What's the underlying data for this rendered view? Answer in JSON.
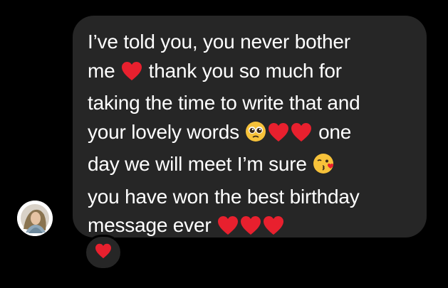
{
  "message": {
    "lines": [
      {
        "before": "I’ve told you, you never bother",
        "emojis": [],
        "after": ""
      },
      {
        "before": "me ",
        "emojis": [
          "heart"
        ],
        "after": " thank you so much for"
      },
      {
        "before": "taking the time to write that and",
        "emojis": [],
        "after": ""
      },
      {
        "before": "your lovely words ",
        "emojis": [
          "pleading-face",
          "heart",
          "heart"
        ],
        "after": " one"
      },
      {
        "before": "day we will meet I’m sure ",
        "emojis": [
          "kissing-heart-face"
        ],
        "after": ""
      },
      {
        "before": "you have won the best birthday",
        "emojis": [],
        "after": ""
      },
      {
        "before": "message ever ",
        "emojis": [
          "heart",
          "heart",
          "heart"
        ],
        "after": ""
      }
    ]
  },
  "reaction": {
    "emoji": "heart"
  },
  "avatar": {
    "icon": "profile-photo-icon"
  },
  "colors": {
    "background": "#000000",
    "bubble": "#262626",
    "text": "#ffffff",
    "heart": "#e8202e",
    "emoji_face": "#f7c23a"
  }
}
